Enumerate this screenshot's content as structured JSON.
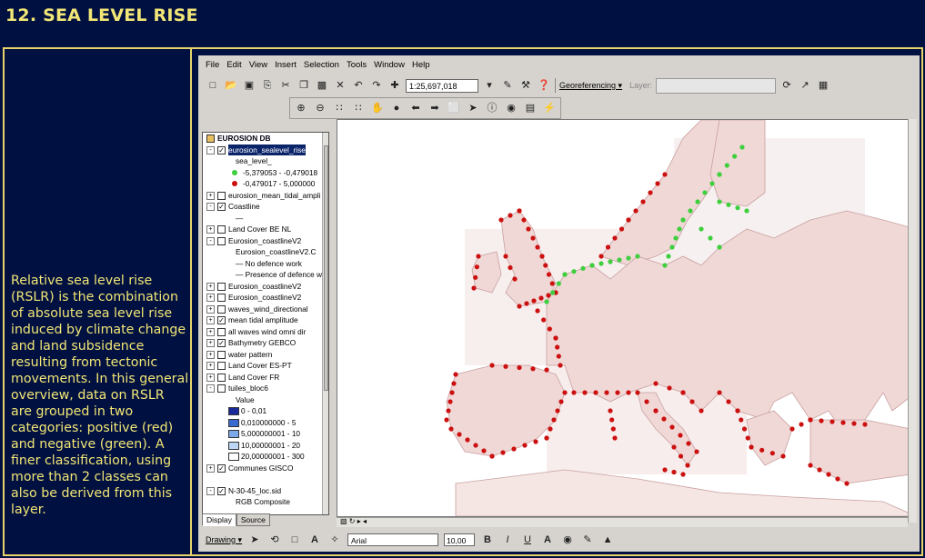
{
  "page": {
    "title": "12. SEA LEVEL RISE",
    "description": "Relative sea level rise (RSLR) is the combination of absolute sea level rise induced by climate change and land subsidence resulting from tectonic movements. In this general overview, data on RSLR are grouped in two categories: positive (red) and negative (green). A finer classification, using more than 2 classes can also be derived from this layer."
  },
  "app": {
    "menu": [
      "File",
      "Edit",
      "View",
      "Insert",
      "Selection",
      "Tools",
      "Window",
      "Help"
    ],
    "scale_value": "1:25,697,018",
    "georeferencing_label": "Georeferencing ▾",
    "layer_label": "Layer:",
    "toc": [
      {
        "text": "EUROSION DB",
        "kind": "db",
        "indent": 0
      },
      {
        "text": "eurosion_sealevel_rise",
        "kind": "layer",
        "checked": true,
        "expand": "-",
        "indent": 0,
        "selected": true
      },
      {
        "text": "sea_level_",
        "kind": "text",
        "indent": 2
      },
      {
        "text": "-5,379053 - -0,479018",
        "kind": "dot",
        "color": "#3ecf3e",
        "indent": 2
      },
      {
        "text": "-0,479017 - 5,000000",
        "kind": "dot",
        "color": "#cc1010",
        "indent": 2
      },
      {
        "text": "eurosion_mean_tidal_ampli",
        "kind": "layer",
        "checked": false,
        "expand": "+",
        "indent": 0
      },
      {
        "text": "Coastline",
        "kind": "layer",
        "checked": true,
        "expand": "-",
        "indent": 0
      },
      {
        "text": "—",
        "kind": "text",
        "indent": 2
      },
      {
        "text": "Land Cover BE NL",
        "kind": "layer",
        "checked": false,
        "expand": "+",
        "indent": 0
      },
      {
        "text": "Eurosion_coastlineV2",
        "kind": "layer",
        "checked": false,
        "expand": "-",
        "indent": 0
      },
      {
        "text": "Eurosion_coastlineV2.C",
        "kind": "text",
        "indent": 2
      },
      {
        "text": "— No defence work",
        "kind": "text",
        "indent": 2
      },
      {
        "text": "— Presence of defence w",
        "kind": "text",
        "indent": 2
      },
      {
        "text": "Eurosion_coastlineV2",
        "kind": "layer",
        "checked": false,
        "expand": "+",
        "indent": 0
      },
      {
        "text": "Eurosion_coastlineV2",
        "kind": "layer",
        "checked": false,
        "expand": "+",
        "indent": 0
      },
      {
        "text": "waves_wind_directional",
        "kind": "layer",
        "checked": false,
        "expand": "+",
        "indent": 0
      },
      {
        "text": "mean tidal amplitude",
        "kind": "layer",
        "checked": true,
        "expand": "+",
        "indent": 0
      },
      {
        "text": "all waves wind omni dir",
        "kind": "layer",
        "checked": false,
        "expand": "+",
        "indent": 0
      },
      {
        "text": "Bathymetry GEBCO",
        "kind": "layer",
        "checked": true,
        "expand": "+",
        "indent": 0
      },
      {
        "text": "water pattern",
        "kind": "layer",
        "checked": false,
        "expand": "+",
        "indent": 0
      },
      {
        "text": "Land Cover ES-PT",
        "kind": "layer",
        "checked": false,
        "expand": "+",
        "indent": 0
      },
      {
        "text": "Land Cover FR",
        "kind": "layer",
        "checked": false,
        "expand": "+",
        "indent": 0
      },
      {
        "text": "tuiles_bloc6",
        "kind": "layer",
        "checked": false,
        "expand": "-",
        "indent": 0
      },
      {
        "text": "Value",
        "kind": "text",
        "indent": 2
      },
      {
        "text": "0 - 0,01",
        "kind": "swatch",
        "color": "#1a2a9a",
        "indent": 2
      },
      {
        "text": "0,010000000 - 5",
        "kind": "swatch",
        "color": "#3a6ad0",
        "indent": 2
      },
      {
        "text": "5,000000001 - 10",
        "kind": "swatch",
        "color": "#7aa8e8",
        "indent": 2
      },
      {
        "text": "10,00000001 - 20",
        "kind": "swatch",
        "color": "#bcd6f4",
        "indent": 2
      },
      {
        "text": "20,00000001 - 300",
        "kind": "swatch",
        "color": "#ffffff",
        "indent": 2
      },
      {
        "text": "Communes GISCO",
        "kind": "layer",
        "checked": true,
        "expand": "+",
        "indent": 0
      },
      {
        "text": "",
        "kind": "text",
        "indent": 0
      },
      {
        "text": "N-30-45_loc.sid",
        "kind": "layer",
        "checked": true,
        "expand": "-",
        "indent": 0
      },
      {
        "text": "RGB Composite",
        "kind": "text",
        "indent": 2
      }
    ],
    "tabs": [
      "Display",
      "Source"
    ],
    "drawing_label": "Drawing ▾",
    "font_name": "Arial",
    "font_size": "10,00",
    "colors": {
      "positive_dot": "#cc1010",
      "negative_dot": "#3ecf3e",
      "land": "#f0d8d6",
      "sea": "#ffffff",
      "frame": "#e8d36a",
      "page_bg": "#001040"
    }
  }
}
